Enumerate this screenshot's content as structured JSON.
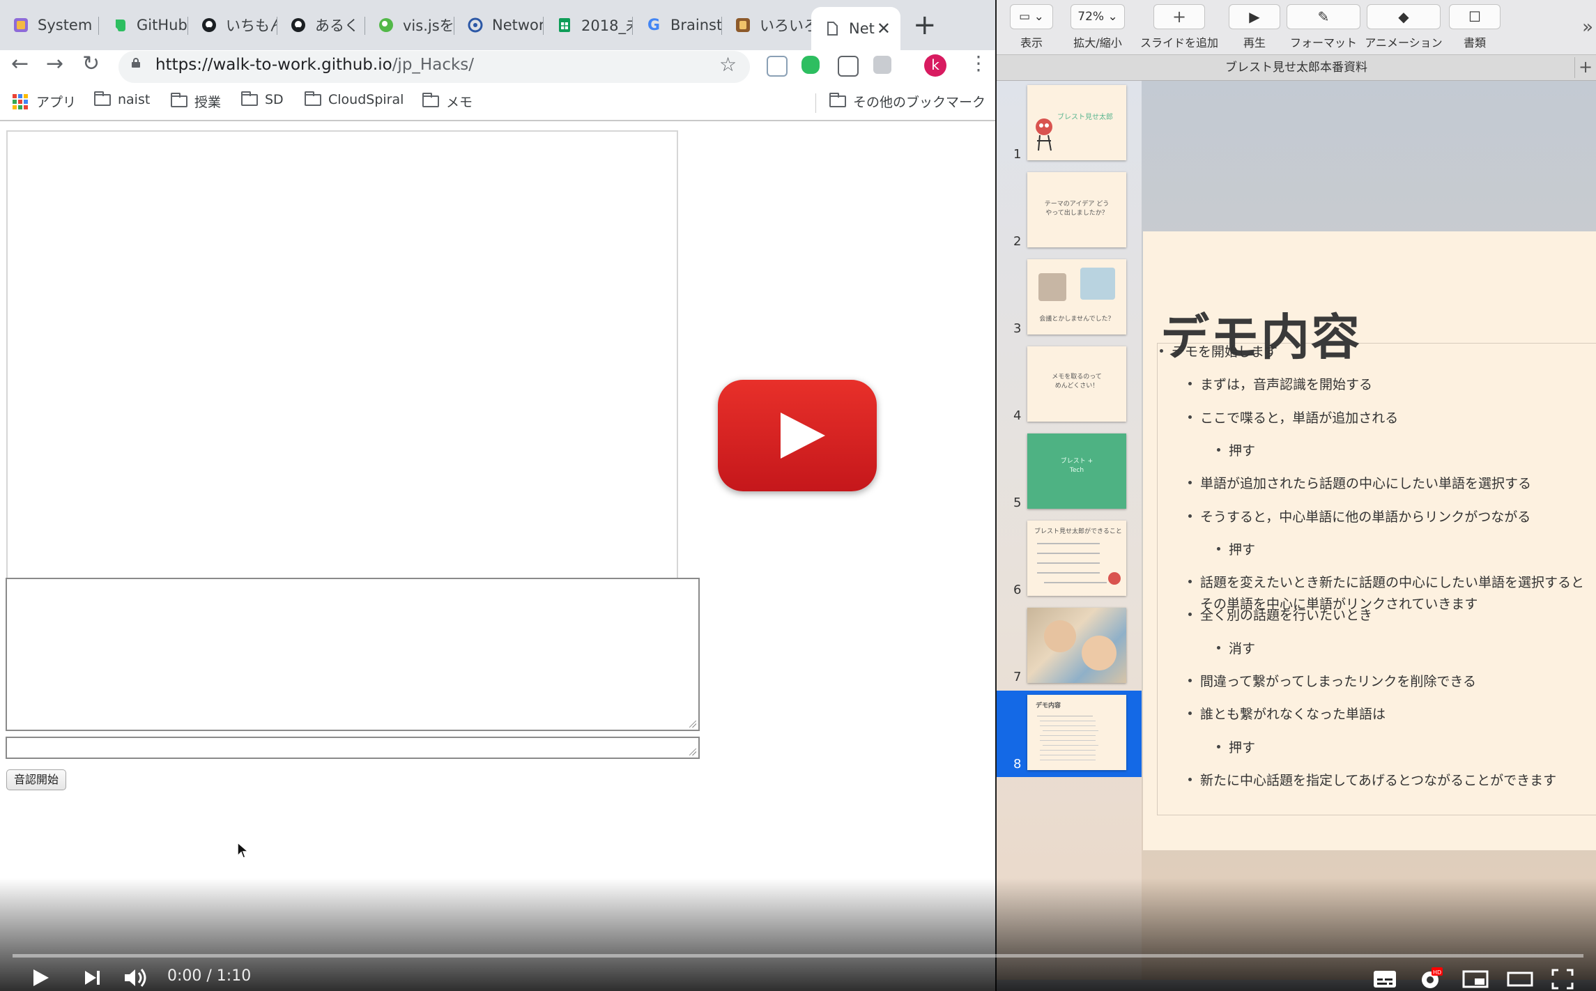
{
  "browser": {
    "tabs": [
      {
        "title": "System",
        "favicon": "system-icon",
        "color": "#7b5cc4"
      },
      {
        "title": "GitHub",
        "favicon": "evernote-icon",
        "color": "#2dbe60"
      },
      {
        "title": "いちもん",
        "favicon": "github-icon",
        "color": "#1b1f23"
      },
      {
        "title": "あるく",
        "favicon": "github-icon",
        "color": "#1b1f23"
      },
      {
        "title": "vis.jsを",
        "favicon": "visjs-icon",
        "color": "#52b848"
      },
      {
        "title": "Networ",
        "favicon": "network-icon",
        "color": "#2c58a6"
      },
      {
        "title": "2018_未",
        "favicon": "sheets-icon",
        "color": "#0f9d58"
      },
      {
        "title": "Brainst",
        "favicon": "google-icon",
        "color": "#4285f4"
      },
      {
        "title": "いろいろ",
        "favicon": "app-icon",
        "color": "#8d5a2b"
      },
      {
        "title": "Net",
        "favicon": "document-icon",
        "color": "#5f6368",
        "active": true
      }
    ],
    "url": {
      "host": "https://walk-to-work.github.io",
      "path": "/jp_Hacks/"
    },
    "avatar_letter": "k",
    "bookmarks": [
      {
        "label": "アプリ",
        "icon": "apps-grid-icon"
      },
      {
        "label": "naist",
        "icon": "folder-icon"
      },
      {
        "label": "授業",
        "icon": "folder-icon"
      },
      {
        "label": "SD",
        "icon": "folder-icon"
      },
      {
        "label": "CloudSpiral",
        "icon": "folder-icon"
      },
      {
        "label": "メモ",
        "icon": "folder-icon"
      }
    ],
    "other_bookmarks": "その他のブックマーク"
  },
  "page": {
    "start_button": "音認開始"
  },
  "keynote": {
    "toolbar": [
      {
        "label": "表示",
        "value": "",
        "icon": "view-icon"
      },
      {
        "label": "拡大/縮小",
        "value": "72%",
        "icon": "zoom-icon"
      },
      {
        "label": "スライドを追加",
        "value": "",
        "icon": "plus-icon"
      },
      {
        "label": "再生",
        "value": "",
        "icon": "play-icon"
      },
      {
        "label": "フォーマット",
        "value": "",
        "icon": "format-brush-icon"
      },
      {
        "label": "アニメーション",
        "value": "",
        "icon": "animation-icon"
      },
      {
        "label": "書類",
        "value": "",
        "icon": "document-icon"
      }
    ],
    "document_title": "ブレスト見せ太郎本番資料",
    "slides": [
      {
        "number": "1",
        "text": "ブレスト見せ太郎"
      },
      {
        "number": "2",
        "text": "テーマのアイデア どうやって出しましたか？"
      },
      {
        "number": "3",
        "text": "会議とかしませんでした？"
      },
      {
        "number": "4",
        "text": "メモを取るのって めんどくさい！"
      },
      {
        "number": "5",
        "text": "ブレスト + Tech"
      },
      {
        "number": "6",
        "text": "ブレスト見せ太郎ができること"
      },
      {
        "number": "7",
        "text": ""
      },
      {
        "number": "8",
        "text": "デモ内容"
      }
    ],
    "current_slide": {
      "title": "デモ内容",
      "bullets": [
        {
          "level": 1,
          "text": "デモを開始します"
        },
        {
          "level": 2,
          "text": "まずは，音声認識を開始する"
        },
        {
          "level": 2,
          "text": "ここで喋ると，単語が追加される"
        },
        {
          "level": 3,
          "text": "押す"
        },
        {
          "level": 2,
          "text": "単語が追加されたら話題の中心にしたい単語を選択する"
        },
        {
          "level": 2,
          "text": "そうすると，中心単語に他の単語からリンクがつながる"
        },
        {
          "level": 3,
          "text": "押す"
        },
        {
          "level": 2,
          "text": "話題を変えたいとき新たに話題の中心にしたい単語を選択すると"
        },
        {
          "level": 0,
          "text": "その単語を中心に単語がリンクされていきます"
        },
        {
          "level": 2,
          "text": "全く別の話題を行いたいとき"
        },
        {
          "level": 3,
          "text": "消す"
        },
        {
          "level": 2,
          "text": "間違って繋がってしまったリンクを削除できる"
        },
        {
          "level": 2,
          "text": "誰とも繋がれなくなった単語は"
        },
        {
          "level": 3,
          "text": "押す"
        },
        {
          "level": 2,
          "text": "新たに中心話題を指定してあげるとつながることができます"
        }
      ]
    }
  },
  "player": {
    "time": "0:00 / 1:10",
    "accent": "#ff0000",
    "controls": [
      "play-icon",
      "next-icon",
      "volume-icon",
      "subtitles-icon",
      "settings-icon",
      "miniplayer-icon",
      "theater-icon",
      "fullscreen-icon"
    ],
    "hd_badge": "HD"
  }
}
